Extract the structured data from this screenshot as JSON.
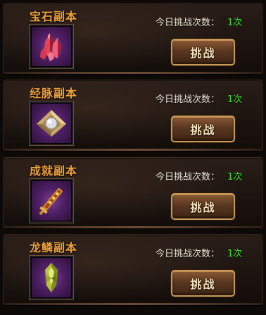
{
  "attempts_label": "今日挑战次数：",
  "button_label": "挑战",
  "colors": {
    "title": "#f0a23c",
    "attempts_value": "#3be12a",
    "button_text": "#f7e4bc"
  },
  "dungeons": [
    {
      "title": "宝石副本",
      "attempts": "1次",
      "icon": "red-crystal-gem-icon"
    },
    {
      "title": "经脉副本",
      "attempts": "1次",
      "icon": "pearl-on-plate-icon"
    },
    {
      "title": "成就副本",
      "attempts": "1次",
      "icon": "golden-scepter-icon"
    },
    {
      "title": "龙鳞副本",
      "attempts": "1次",
      "icon": "dragon-scale-icon"
    }
  ]
}
